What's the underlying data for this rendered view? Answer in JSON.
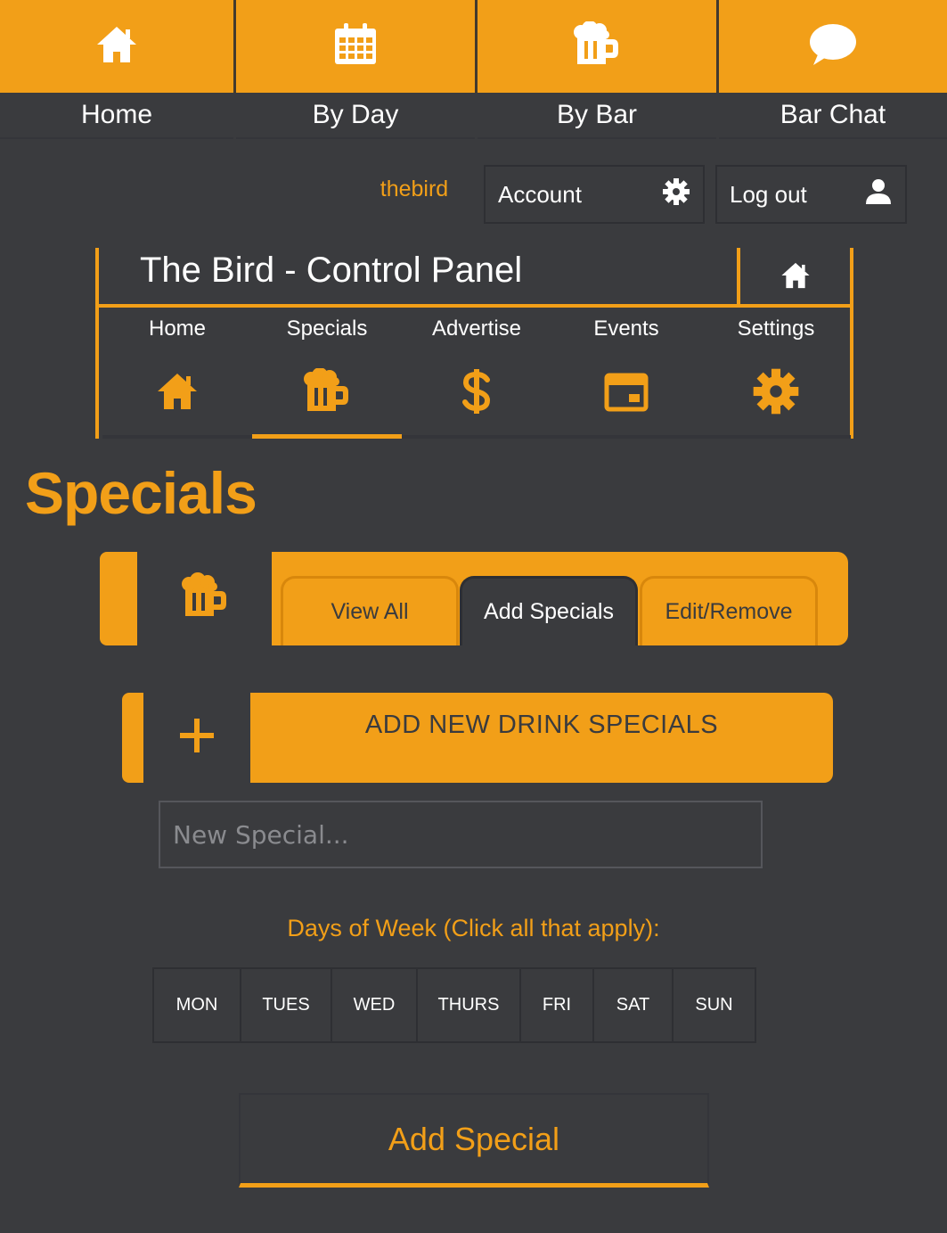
{
  "colors": {
    "accent": "#f29f18",
    "background": "#3a3b3e",
    "text": "#ffffff"
  },
  "topnav": {
    "items": [
      {
        "label": "Home",
        "icon": "home-icon"
      },
      {
        "label": "By Day",
        "icon": "calendar-icon"
      },
      {
        "label": "By Bar",
        "icon": "beer-mug-icon"
      },
      {
        "label": "Bar Chat",
        "icon": "chat-bubble-icon"
      }
    ]
  },
  "user": {
    "username": "thebird",
    "account_label": "Account",
    "logout_label": "Log out"
  },
  "control_panel": {
    "title": "The Bird - Control Panel",
    "tabs": [
      {
        "label": "Home",
        "icon": "home-icon"
      },
      {
        "label": "Specials",
        "icon": "beer-mug-icon",
        "active": true
      },
      {
        "label": "Advertise",
        "icon": "dollar-icon"
      },
      {
        "label": "Events",
        "icon": "calendar-icon"
      },
      {
        "label": "Settings",
        "icon": "gear-icon"
      }
    ]
  },
  "page": {
    "heading": "Specials"
  },
  "specials_tabs": [
    {
      "label": "View All"
    },
    {
      "label": "Add Specials",
      "active": true
    },
    {
      "label": "Edit/Remove"
    }
  ],
  "add_form": {
    "section_label": "ADD NEW DRINK SPECIALS",
    "input_placeholder": "New Special...",
    "input_value": "",
    "days_label": "Days of Week (Click all that apply):",
    "days": [
      "MON",
      "TUES",
      "WED",
      "THURS",
      "FRI",
      "SAT",
      "SUN"
    ],
    "submit_label": "Add Special"
  }
}
